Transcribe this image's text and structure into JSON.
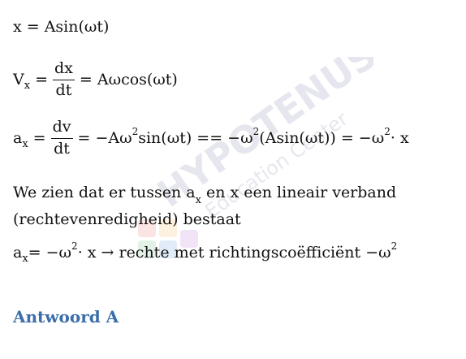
{
  "watermark": {
    "brand": "HYPOTENUSE",
    "tagline": "Education Center"
  },
  "eq1": {
    "text": "x = Asin(ωt)"
  },
  "eq2": {
    "lhs_base": "V",
    "lhs_sub": "x",
    "eq": "=",
    "frac_num": "dx",
    "frac_den": "dt",
    "rhs": "= Aωcos(ωt)"
  },
  "eq3": {
    "lhs_base": "a",
    "lhs_sub": "x",
    "eq": "=",
    "frac_num": "dv",
    "frac_den": "dt",
    "rhs_a": "= −Aω",
    "sup_a": "2",
    "rhs_b": " sin(ωt) == −ω",
    "sup_b": "2",
    "rhs_c": "(Asin(ωt)) = −ω",
    "sup_c": "2",
    "rhs_d": " · x"
  },
  "paragraph": {
    "part1": "We zien dat er tussen a",
    "sub": "x",
    "part2": " en x een lineair verband",
    "line2": "(rechtevenredigheid) bestaat"
  },
  "eq4": {
    "lhs_base": "a",
    "lhs_sub": "x",
    "rhs_a": " = −ω",
    "sup_a": "2",
    "rhs_b": " · x → rechte met richtingscoëfficiënt −ω",
    "sup_b": "2"
  },
  "answer": {
    "label": "Antwoord A",
    "color": "#3b6ea8"
  }
}
